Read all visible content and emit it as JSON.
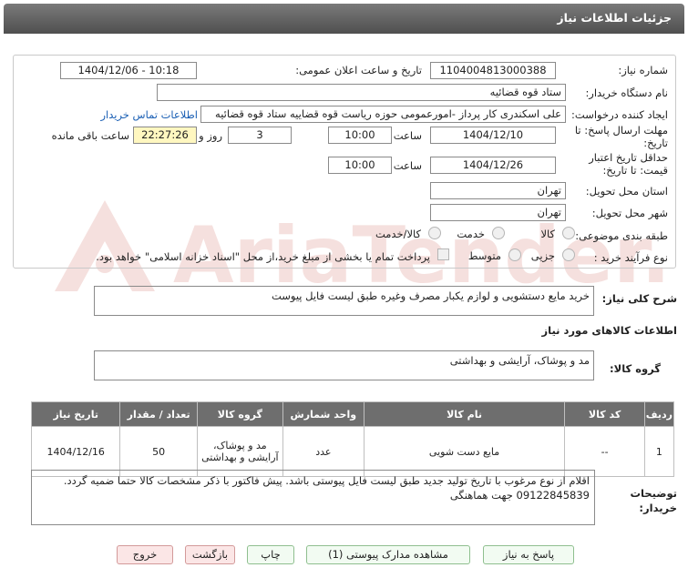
{
  "header": {
    "title": "جزئیات اطلاعات نیاز"
  },
  "form": {
    "need_number_label": "شماره نیاز:",
    "need_number": "1104004813000388",
    "announce_label": "تاریخ و ساعت اعلان عمومی:",
    "announce_value": "1404/12/06 - 10:18",
    "buyer_org_label": "نام دستگاه خریدار:",
    "buyer_org": "ستاد قوه قضائیه",
    "creator_label": "ایجاد کننده درخواست:",
    "creator": "علی اسکندری کار پرداز -امورعمومی حوزه ریاست قوه قضاییه ستاد قوه قضائیه",
    "contact_link": "اطلاعات تماس خریدار",
    "deadline_label": "مهلت ارسال پاسخ: تا تاریخ:",
    "deadline_date": "1404/12/10",
    "time_label": "ساعت",
    "deadline_time": "10:00",
    "days": "3",
    "days_label": "روز و",
    "remaining_time": "22:27:26",
    "remaining_label": "ساعت باقی مانده",
    "validity_label": "حداقل تاریخ اعتبار قیمت: تا تاریخ:",
    "validity_date": "1404/12/26",
    "validity_time": "10:00",
    "province_label": "استان محل تحویل:",
    "province": "تهران",
    "city_label": "شهر محل تحویل:",
    "city": "تهران",
    "category_label": "طبقه بندی موضوعی:",
    "category_options": [
      "کالا",
      "خدمت",
      "کالا/خدمت"
    ],
    "process_label": "نوع فرآیند خرید :",
    "process_options": [
      "جزیی",
      "متوسط"
    ],
    "payment_note": "پرداخت تمام یا بخشی از مبلغ خرید،از محل \"اسناد خزانه اسلامی\" خواهد بود."
  },
  "summary": {
    "label": "شرح کلی نیاز:",
    "text": "خرید مایع دستشویی و لوازم یکبار مصرف وغیره طبق لیست فایل پیوست"
  },
  "goods": {
    "section_title": "اطلاعات کالاهای مورد نیاز",
    "group_label": "گروه کالا:",
    "group_value": "مد و پوشاک، آرایشی و بهداشتی",
    "table": {
      "headers": [
        "ردیف",
        "کد کالا",
        "نام کالا",
        "واحد شمارش",
        "گروه کالا",
        "تعداد / مقدار",
        "تاریخ نیاز"
      ],
      "rows": [
        {
          "row": "1",
          "code": "--",
          "name": "مایع دست شویی",
          "unit": "عدد",
          "group": "مد و پوشاک، آرایشی و بهداشتی",
          "qty": "50",
          "date": "1404/12/16"
        }
      ]
    }
  },
  "buyer_notes": {
    "label": "توضیحات خریدار:",
    "text": "اقلام از نوع مرغوب با تاریخ تولید جدید طبق لیست فایل پیوستی باشد. پیش فاکتور با ذکر مشخصات کالا حتما ضمیه گردد. 09122845839 جهت هماهنگی"
  },
  "buttons": {
    "reply": "پاسخ به نیاز",
    "attachments": "مشاهده مدارک پیوستی (1)",
    "print": "چاپ",
    "back": "بازگشت",
    "exit": "خروج"
  },
  "watermark": {
    "text": "AriaTender.net"
  }
}
